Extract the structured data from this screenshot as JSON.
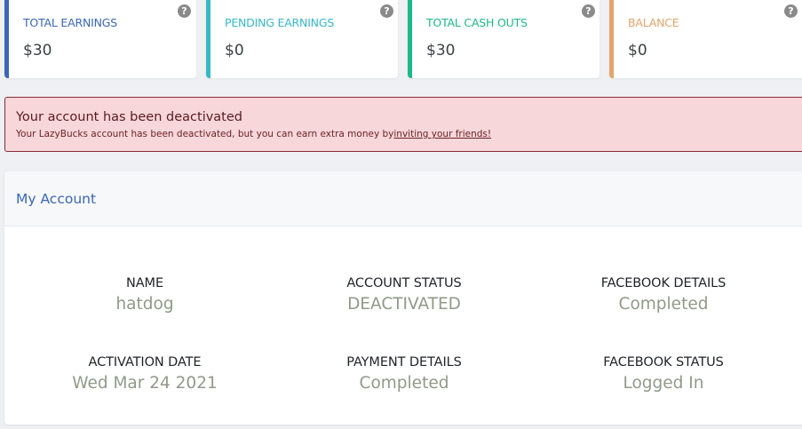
{
  "cards": [
    {
      "label": "TOTAL EARNINGS",
      "value": "$30",
      "color": "#3a66b8",
      "help": "?"
    },
    {
      "label": "PENDING EARNINGS",
      "value": "$0",
      "color": "#36b8c8",
      "help": "?"
    },
    {
      "label": "TOTAL CASH OUTS",
      "value": "$30",
      "color": "#1fb888",
      "help": "?"
    },
    {
      "label": "BALANCE",
      "value": "$0",
      "color": "#e3a46a",
      "help": "?"
    }
  ],
  "alert": {
    "title": "Your account has been deactivated",
    "message": "Your LazyBucks account has been deactivated, but you can earn extra money by",
    "link_text": "inviting your friends!"
  },
  "account": {
    "title": "My Account",
    "fields": [
      {
        "label": "NAME",
        "value": "hatdog"
      },
      {
        "label": "ACCOUNT STATUS",
        "value": "DEACTIVATED"
      },
      {
        "label": "FACEBOOK DETAILS",
        "value": "Completed"
      },
      {
        "label": "ACTIVATION DATE",
        "value": "Wed Mar 24 2021"
      },
      {
        "label": "PAYMENT DETAILS",
        "value": "Completed"
      },
      {
        "label": "FACEBOOK STATUS",
        "value": "Logged In"
      }
    ]
  },
  "icons": {
    "help": "help-circle-icon"
  }
}
